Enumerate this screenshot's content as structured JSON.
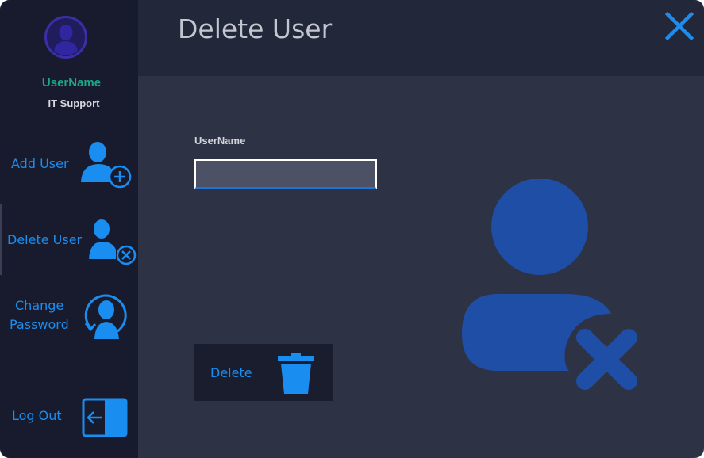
{
  "window": {
    "title": "Delete User"
  },
  "sidebar": {
    "profile": {
      "name": "UserName",
      "role": "IT Support",
      "avatar_icon": "user-avatar-icon"
    },
    "items": [
      {
        "label": "Add User",
        "icon": "add-user-icon",
        "active": false
      },
      {
        "label": "Delete User",
        "icon": "delete-user-icon",
        "active": true
      },
      {
        "label_line1": "Change",
        "label_line2": "Password",
        "icon": "change-password-icon",
        "active": false
      },
      {
        "label": "Log Out",
        "icon": "logout-icon",
        "active": false
      }
    ]
  },
  "form": {
    "username_label": "UserName",
    "username_value": "",
    "delete_label": "Delete"
  },
  "colors": {
    "sidebar_bg": "#181b2d",
    "header_bg": "#23273a",
    "content_bg": "#2e3245",
    "accent_blue": "#1a8ef0",
    "profile_name": "#1ea486",
    "illustration_blue": "#1f4ea6"
  }
}
